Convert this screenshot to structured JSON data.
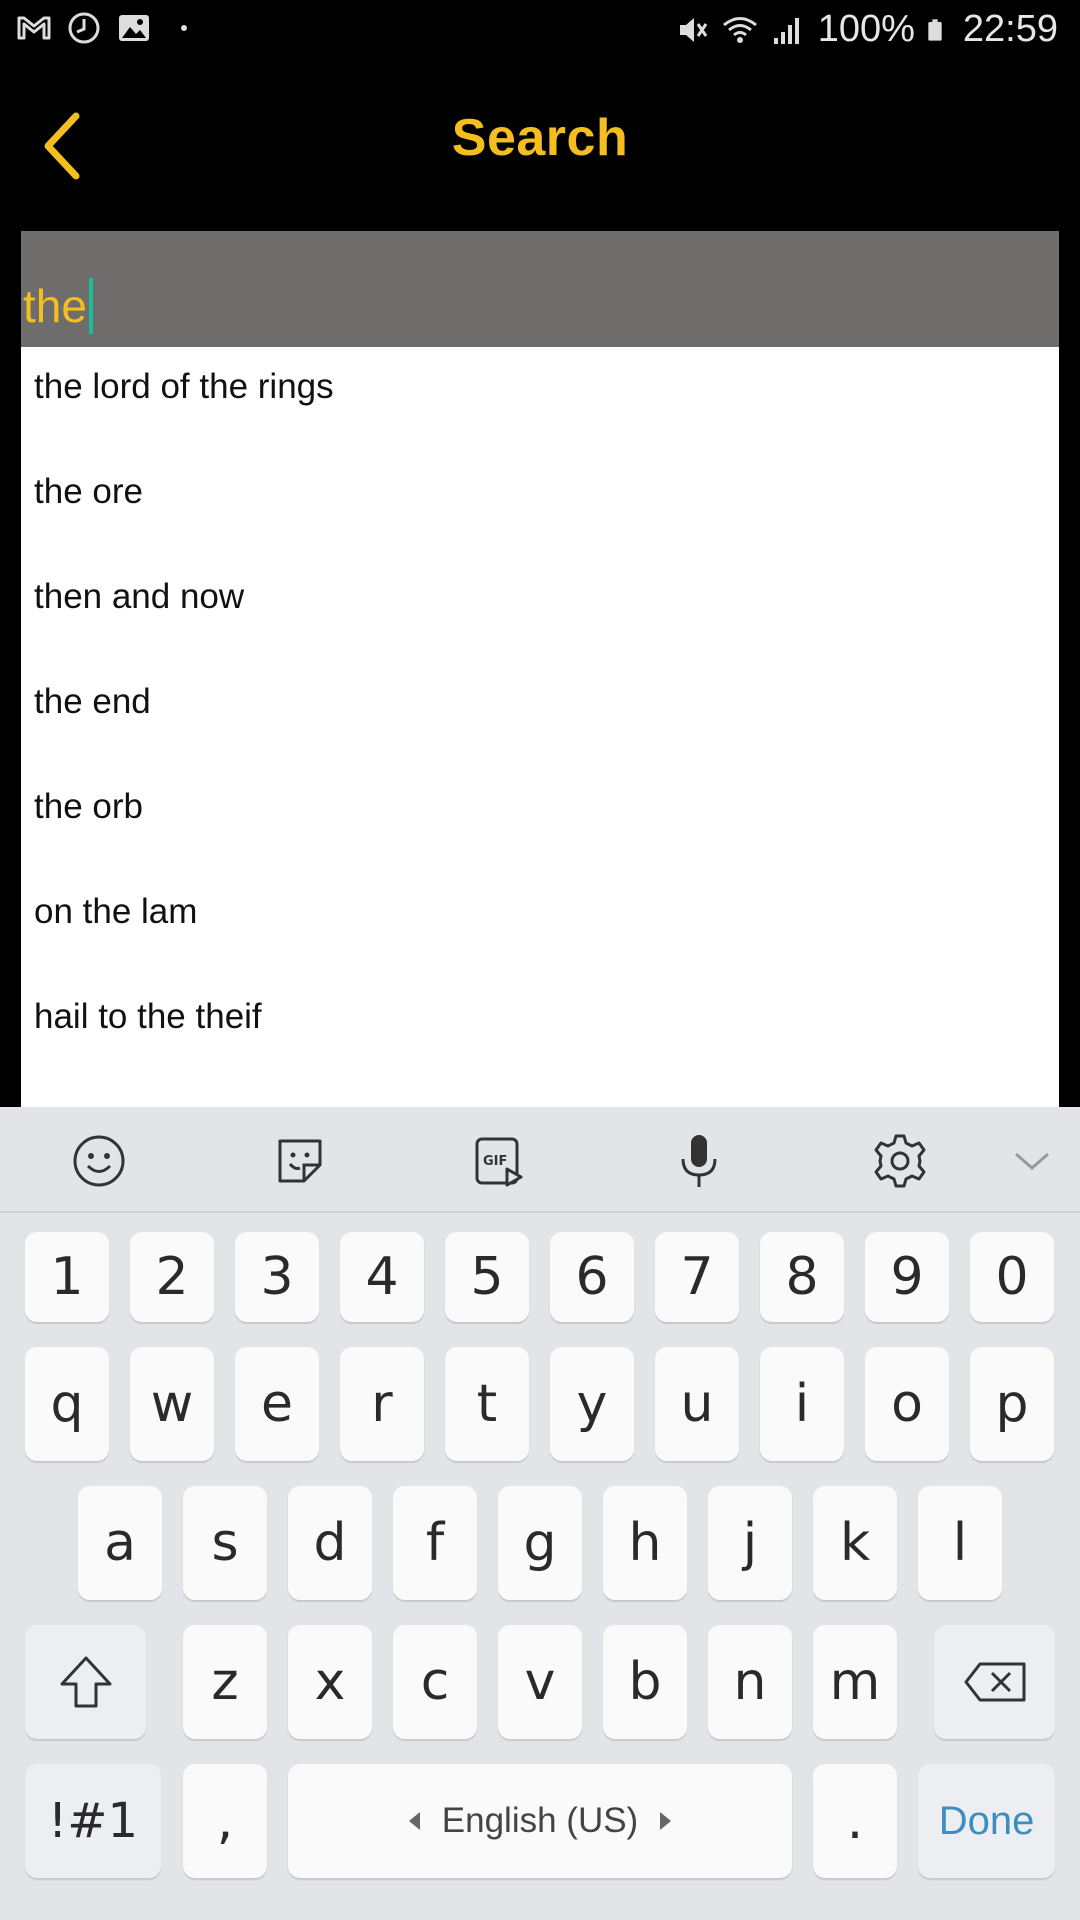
{
  "status_bar": {
    "battery_percent": "100%",
    "time": "22:59",
    "left_icons": [
      "gmail-icon",
      "sync-icon",
      "gallery-icon",
      "dot-icon"
    ],
    "right_icons": [
      "mute-icon",
      "wifi-icon",
      "signal-icon",
      "battery-icon"
    ]
  },
  "app_bar": {
    "title": "Search",
    "accent_color": "#F5BE1F"
  },
  "search": {
    "value": "the"
  },
  "suggestions": [
    "the lord of the rings",
    "the ore",
    "then and now",
    "the end",
    "the orb",
    "on the lam",
    "hail to the theif"
  ],
  "keyboard": {
    "toolbar_icons": [
      "emoji-icon",
      "sticker-icon",
      "gif-icon",
      "microphone-icon",
      "settings-icon",
      "collapse-chevron-icon"
    ],
    "row_numbers": [
      "1",
      "2",
      "3",
      "4",
      "5",
      "6",
      "7",
      "8",
      "9",
      "0"
    ],
    "row_1": [
      "q",
      "w",
      "e",
      "r",
      "t",
      "y",
      "u",
      "i",
      "o",
      "p"
    ],
    "row_2": [
      "a",
      "s",
      "d",
      "f",
      "g",
      "h",
      "j",
      "k",
      "l"
    ],
    "row_3": [
      "z",
      "x",
      "c",
      "v",
      "b",
      "n",
      "m"
    ],
    "symbols_label": "!#1",
    "comma_label": ",",
    "space_label": "English (US)",
    "period_label": ".",
    "done_label": "Done",
    "done_color": "#3D8FC2"
  }
}
